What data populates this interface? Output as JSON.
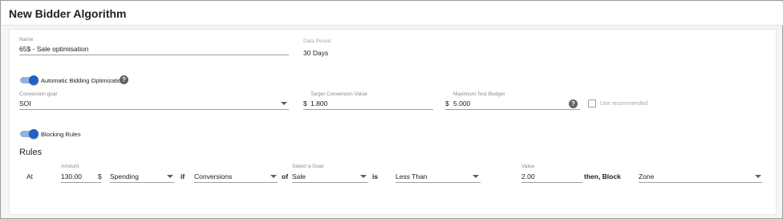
{
  "page": {
    "title": "New Bidder Algorithm"
  },
  "name_field": {
    "label": "Name",
    "value": "65$ - Sale optimisation"
  },
  "data_period": {
    "label": "Data Period",
    "value": "30 Days"
  },
  "auto_bidding": {
    "label": "Automatic Bidding Optimization",
    "enabled": true
  },
  "conversion_goal": {
    "label": "Conversion goal",
    "value": "SOI"
  },
  "target_conversion": {
    "label": "Target Conversion Value",
    "currency": "$",
    "value": "1.800"
  },
  "max_test_budget": {
    "label": "Maximum Test Budget",
    "currency": "$",
    "value": "5.000"
  },
  "use_recommended": {
    "label": "Use recommended",
    "checked": false
  },
  "blocking_rules": {
    "label": "Blocking Rules",
    "enabled": true
  },
  "rules": {
    "title": "Rules",
    "at_word": "At",
    "amount_label": "Amount",
    "amount_value": "130.00",
    "amount_currency": "$",
    "metric_value": "Spending",
    "if_word": "if",
    "event_value": "Conversions",
    "of_word": "of",
    "goal_label": "Select a Goal",
    "goal_value": "Sale",
    "is_word": "is",
    "comparison_value": "Less Than",
    "value_label": "Value",
    "value_value": "2.00",
    "then_word": "then, Block",
    "block_target": "Zone"
  },
  "colors": {
    "accent": "#1f62c0",
    "accent_track": "#8fb3e0"
  },
  "icons": {
    "help": "help-circle-icon",
    "dropdown": "caret-down-icon"
  }
}
